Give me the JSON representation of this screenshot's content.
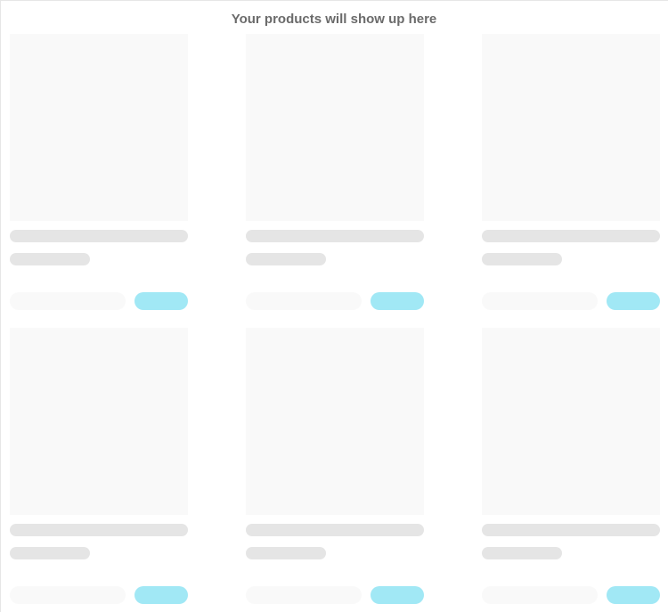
{
  "header": {
    "title": "Your products will show up here"
  },
  "colors": {
    "image_placeholder": "#f9f9f9",
    "line_placeholder": "#e5e5e5",
    "price_placeholder": "#f9f9f9",
    "action_accent": "#a1e8f5",
    "heading_text": "#6b6b6b"
  },
  "grid": {
    "rows": 2,
    "columns": 3,
    "cards": 6
  }
}
